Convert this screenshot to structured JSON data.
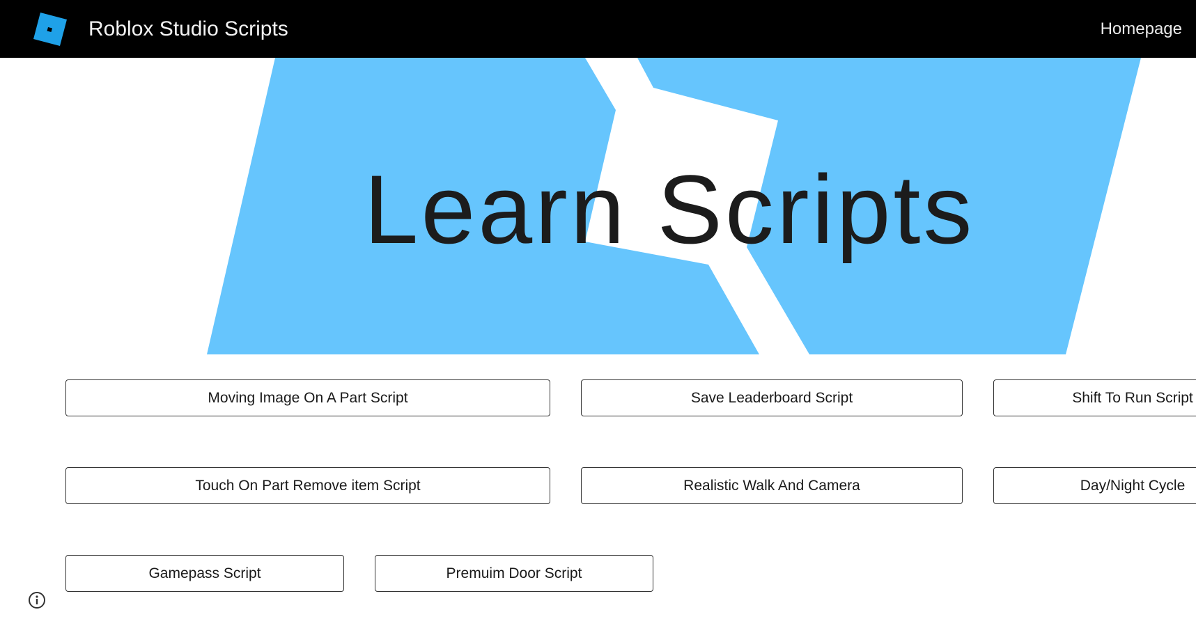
{
  "header": {
    "site_title": "Roblox Studio Scripts",
    "nav_home": "Homepage",
    "logo_icon": "roblox-logo-icon",
    "logo_color": "#1fa1e8"
  },
  "hero": {
    "title": "Learn Scripts",
    "background_color": "#66c5fd"
  },
  "scripts": [
    {
      "label": "Moving Image On A Part Script"
    },
    {
      "label": "Save Leaderboard Script"
    },
    {
      "label": "Shift To Run Script"
    },
    {
      "label": "Touch On Part Remove item Script"
    },
    {
      "label": "Realistic Walk And Camera"
    },
    {
      "label": "Day/Night Cycle"
    },
    {
      "label": "Gamepass Script"
    },
    {
      "label": "Premuim Door Script"
    }
  ],
  "footer": {
    "info_icon": "info-icon"
  }
}
